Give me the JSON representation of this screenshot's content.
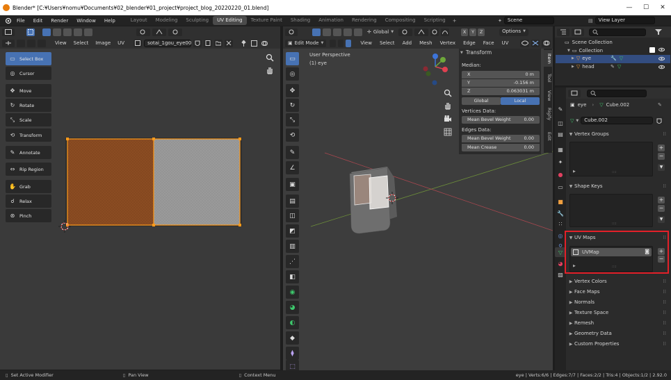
{
  "window": {
    "title": "Blender* [C:¥Users¥nomu¥Documents¥02_blender¥01_project¥project_blog_20220220_01.blend]"
  },
  "menu": {
    "items": [
      "File",
      "Edit",
      "Render",
      "Window",
      "Help"
    ]
  },
  "workspaces": [
    "Layout",
    "Modeling",
    "Sculpting",
    "UV Editing",
    "Texture Paint",
    "Shading",
    "Animation",
    "Rendering",
    "Compositing",
    "Scripting"
  ],
  "workspace_active": "UV Editing",
  "scene": {
    "label": "Scene",
    "view_layer": "View Layer"
  },
  "uv_editor": {
    "header_menus": [
      "View",
      "Select",
      "Image",
      "UV"
    ],
    "image_name": "sotai_1gou_eye00",
    "tools": [
      "Select Box",
      "Cursor",
      "Move",
      "Rotate",
      "Scale",
      "Transform",
      "Annotate",
      "Rip Region",
      "Grab",
      "Relax",
      "Pinch"
    ]
  },
  "viewport": {
    "mode": "Edit Mode",
    "header_menus": [
      "View",
      "Select",
      "Add",
      "Mesh",
      "Vertex",
      "Edge",
      "Face",
      "UV"
    ],
    "transform_orientation": "Global",
    "axes": [
      "X",
      "Y",
      "Z"
    ],
    "options_label": "Options",
    "overlay_line1": "User Perspective",
    "overlay_line2": "(1) eye",
    "side_tabs": [
      "Item",
      "Tool",
      "View",
      "Rigify",
      "Edit"
    ]
  },
  "transform_panel": {
    "title": "Transform",
    "median_label": "Median:",
    "x_label": "X",
    "x_value": "0 m",
    "y_label": "Y",
    "y_value": "-0.156 m",
    "z_label": "Z",
    "z_value": "0.063031 m",
    "global_label": "Global",
    "local_label": "Local",
    "vertices_label": "Vertices Data:",
    "mean_bevel_weight_label": "Mean Bevel Weight",
    "vertex_bevel_value": "0.00",
    "edges_label": "Edges Data:",
    "edge_bevel_value": "0.00",
    "mean_crease_label": "Mean Crease",
    "mean_crease_value": "0.00"
  },
  "outliner": {
    "scene_collection": "Scene Collection",
    "collection": "Collection",
    "objects": [
      "eye",
      "head"
    ]
  },
  "properties": {
    "object_name": "eye",
    "mesh_name": "Cube.002",
    "data_field": "Cube.002",
    "sections": {
      "vertex_groups": "Vertex Groups",
      "shape_keys": "Shape Keys",
      "uv_maps": "UV Maps",
      "collapsed": [
        "Vertex Colors",
        "Face Maps",
        "Normals",
        "Texture Space",
        "Remesh",
        "Geometry Data",
        "Custom Properties"
      ]
    },
    "uv_map_item": "UVMap"
  },
  "status_bar": {
    "left": "Set Active Modifier",
    "middle": "Pan View",
    "right": "Context Menu",
    "stats": "eye | Verts:6/6 | Edges:7/7 | Faces:2/2 | Tris:4 | Objects:1/2 | 2.92.0"
  },
  "colors": {
    "accent": "#4772b3",
    "highlight": "#e32029",
    "uv_face": "#8a4c24",
    "vertex": "#ff9a1a"
  }
}
